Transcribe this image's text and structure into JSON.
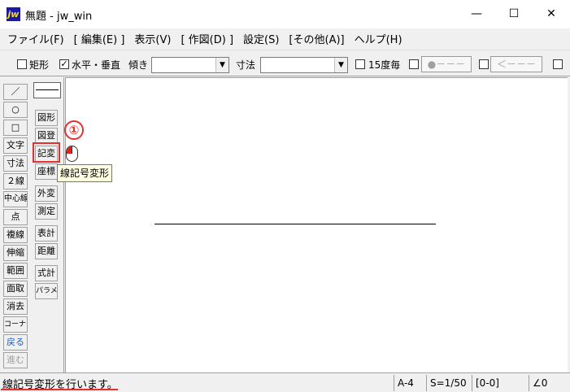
{
  "window": {
    "icon_text": "jw",
    "title": "無題 - jw_win",
    "minimize": "—",
    "maximize": "☐",
    "close": "✕"
  },
  "menu": [
    "ファイル(F)",
    "[ 編集(E) ]",
    "表示(V)",
    "[ 作図(D) ]",
    "設定(S)",
    "[その他(A)]",
    "ヘルプ(H)"
  ],
  "toolbar": {
    "rect_label": "矩形",
    "rect_checked": false,
    "hv_label": "水平・垂直",
    "hv_checked": true,
    "tilt_label": "傾き",
    "tilt_value": "",
    "dim_label": "寸法",
    "dim_value": "",
    "deg15_label": "15度毎",
    "deg15_checked": false,
    "arrow_btn1": "●－－－",
    "arrow_btn2": "＜－－－"
  },
  "left_tools": [
    "／",
    "○",
    "□",
    "文字",
    "寸法",
    "２線",
    "中心線",
    "点",
    "複線",
    "伸縮",
    "範囲",
    "面取",
    "消去",
    "コーナー",
    "戻る",
    "進む"
  ],
  "sub_tools": [
    "図形",
    "図登",
    "記変",
    "座標",
    "外変",
    "測定",
    "表計",
    "距離",
    "式計",
    "パラメ"
  ],
  "annotation": {
    "step": "①",
    "tooltip": "線記号変形"
  },
  "status": {
    "message": "線記号変形を行います。",
    "paper": "A-4",
    "scale": "S=1/50",
    "layer": "[0-0]",
    "angle": "∠0"
  },
  "colors": {
    "highlight": "#e53030",
    "tooltip_bg": "#ffffe1"
  }
}
